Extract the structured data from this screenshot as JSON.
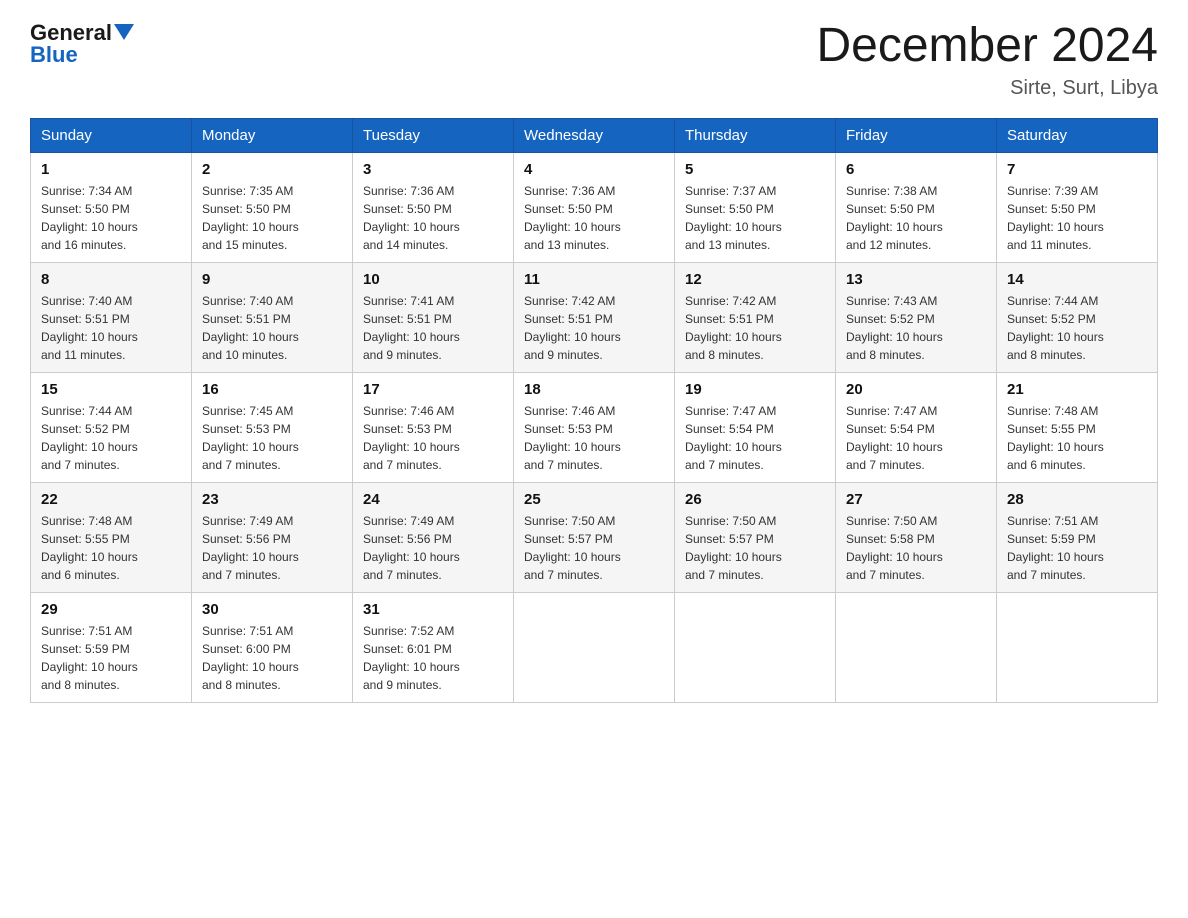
{
  "logo": {
    "general": "General",
    "blue": "Blue"
  },
  "header": {
    "title": "December 2024",
    "subtitle": "Sirte, Surt, Libya"
  },
  "days_of_week": [
    "Sunday",
    "Monday",
    "Tuesday",
    "Wednesday",
    "Thursday",
    "Friday",
    "Saturday"
  ],
  "weeks": [
    [
      {
        "day": "1",
        "sunrise": "7:34 AM",
        "sunset": "5:50 PM",
        "daylight": "10 hours and 16 minutes."
      },
      {
        "day": "2",
        "sunrise": "7:35 AM",
        "sunset": "5:50 PM",
        "daylight": "10 hours and 15 minutes."
      },
      {
        "day": "3",
        "sunrise": "7:36 AM",
        "sunset": "5:50 PM",
        "daylight": "10 hours and 14 minutes."
      },
      {
        "day": "4",
        "sunrise": "7:36 AM",
        "sunset": "5:50 PM",
        "daylight": "10 hours and 13 minutes."
      },
      {
        "day": "5",
        "sunrise": "7:37 AM",
        "sunset": "5:50 PM",
        "daylight": "10 hours and 13 minutes."
      },
      {
        "day": "6",
        "sunrise": "7:38 AM",
        "sunset": "5:50 PM",
        "daylight": "10 hours and 12 minutes."
      },
      {
        "day": "7",
        "sunrise": "7:39 AM",
        "sunset": "5:50 PM",
        "daylight": "10 hours and 11 minutes."
      }
    ],
    [
      {
        "day": "8",
        "sunrise": "7:40 AM",
        "sunset": "5:51 PM",
        "daylight": "10 hours and 11 minutes."
      },
      {
        "day": "9",
        "sunrise": "7:40 AM",
        "sunset": "5:51 PM",
        "daylight": "10 hours and 10 minutes."
      },
      {
        "day": "10",
        "sunrise": "7:41 AM",
        "sunset": "5:51 PM",
        "daylight": "10 hours and 9 minutes."
      },
      {
        "day": "11",
        "sunrise": "7:42 AM",
        "sunset": "5:51 PM",
        "daylight": "10 hours and 9 minutes."
      },
      {
        "day": "12",
        "sunrise": "7:42 AM",
        "sunset": "5:51 PM",
        "daylight": "10 hours and 8 minutes."
      },
      {
        "day": "13",
        "sunrise": "7:43 AM",
        "sunset": "5:52 PM",
        "daylight": "10 hours and 8 minutes."
      },
      {
        "day": "14",
        "sunrise": "7:44 AM",
        "sunset": "5:52 PM",
        "daylight": "10 hours and 8 minutes."
      }
    ],
    [
      {
        "day": "15",
        "sunrise": "7:44 AM",
        "sunset": "5:52 PM",
        "daylight": "10 hours and 7 minutes."
      },
      {
        "day": "16",
        "sunrise": "7:45 AM",
        "sunset": "5:53 PM",
        "daylight": "10 hours and 7 minutes."
      },
      {
        "day": "17",
        "sunrise": "7:46 AM",
        "sunset": "5:53 PM",
        "daylight": "10 hours and 7 minutes."
      },
      {
        "day": "18",
        "sunrise": "7:46 AM",
        "sunset": "5:53 PM",
        "daylight": "10 hours and 7 minutes."
      },
      {
        "day": "19",
        "sunrise": "7:47 AM",
        "sunset": "5:54 PM",
        "daylight": "10 hours and 7 minutes."
      },
      {
        "day": "20",
        "sunrise": "7:47 AM",
        "sunset": "5:54 PM",
        "daylight": "10 hours and 7 minutes."
      },
      {
        "day": "21",
        "sunrise": "7:48 AM",
        "sunset": "5:55 PM",
        "daylight": "10 hours and 6 minutes."
      }
    ],
    [
      {
        "day": "22",
        "sunrise": "7:48 AM",
        "sunset": "5:55 PM",
        "daylight": "10 hours and 6 minutes."
      },
      {
        "day": "23",
        "sunrise": "7:49 AM",
        "sunset": "5:56 PM",
        "daylight": "10 hours and 7 minutes."
      },
      {
        "day": "24",
        "sunrise": "7:49 AM",
        "sunset": "5:56 PM",
        "daylight": "10 hours and 7 minutes."
      },
      {
        "day": "25",
        "sunrise": "7:50 AM",
        "sunset": "5:57 PM",
        "daylight": "10 hours and 7 minutes."
      },
      {
        "day": "26",
        "sunrise": "7:50 AM",
        "sunset": "5:57 PM",
        "daylight": "10 hours and 7 minutes."
      },
      {
        "day": "27",
        "sunrise": "7:50 AM",
        "sunset": "5:58 PM",
        "daylight": "10 hours and 7 minutes."
      },
      {
        "day": "28",
        "sunrise": "7:51 AM",
        "sunset": "5:59 PM",
        "daylight": "10 hours and 7 minutes."
      }
    ],
    [
      {
        "day": "29",
        "sunrise": "7:51 AM",
        "sunset": "5:59 PM",
        "daylight": "10 hours and 8 minutes."
      },
      {
        "day": "30",
        "sunrise": "7:51 AM",
        "sunset": "6:00 PM",
        "daylight": "10 hours and 8 minutes."
      },
      {
        "day": "31",
        "sunrise": "7:52 AM",
        "sunset": "6:01 PM",
        "daylight": "10 hours and 9 minutes."
      },
      null,
      null,
      null,
      null
    ]
  ],
  "labels": {
    "sunrise": "Sunrise:",
    "sunset": "Sunset:",
    "daylight": "Daylight:"
  }
}
